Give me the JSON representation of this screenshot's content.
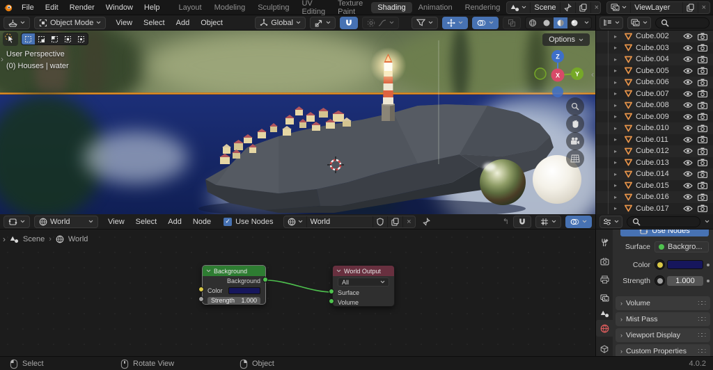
{
  "topbar": {
    "menus": [
      "File",
      "Edit",
      "Render",
      "Window",
      "Help"
    ],
    "workspaces": [
      "Layout",
      "Modeling",
      "Sculpting",
      "UV Editing",
      "Texture Paint",
      "Shading",
      "Animation",
      "Rendering"
    ],
    "active_workspace": "Shading",
    "scene": {
      "value": "Scene"
    },
    "view_layer": {
      "value": "ViewLayer"
    }
  },
  "viewport": {
    "header": {
      "mode": "Object Mode",
      "menus": [
        "View",
        "Select",
        "Add",
        "Object"
      ],
      "orientation": "Global"
    },
    "options_button": "Options",
    "overlay_line1": "User Perspective",
    "overlay_line2": "(0) Houses | water",
    "gizmo": {
      "x": "X",
      "y": "Y",
      "z": "Z"
    }
  },
  "outliner": {
    "items": [
      "Cube.002",
      "Cube.003",
      "Cube.004",
      "Cube.005",
      "Cube.006",
      "Cube.007",
      "Cube.008",
      "Cube.009",
      "Cube.010",
      "Cube.011",
      "Cube.012",
      "Cube.013",
      "Cube.014",
      "Cube.015",
      "Cube.016",
      "Cube.017"
    ]
  },
  "node_editor": {
    "header": {
      "shader_type": "World",
      "menus": [
        "View",
        "Select",
        "Add",
        "Node"
      ],
      "use_nodes": "Use Nodes",
      "id_name": "World"
    },
    "breadcrumb": {
      "scene": "Scene",
      "world": "World"
    },
    "background_node": {
      "title": "Background",
      "output_label": "Background",
      "color_label": "Color",
      "strength_label": "Strength",
      "strength_value": "1.000"
    },
    "output_node": {
      "title": "World Output",
      "target": "All",
      "surface_label": "Surface",
      "volume_label": "Volume"
    }
  },
  "properties": {
    "use_nodes_button": "Use Nodes",
    "surface": {
      "label": "Surface",
      "value": "Backgro..."
    },
    "color": {
      "label": "Color"
    },
    "strength": {
      "label": "Strength",
      "value": "1.000"
    },
    "panels": [
      "Volume",
      "Mist Pass",
      "Viewport Display",
      "Custom Properties"
    ]
  },
  "statusbar": {
    "keymap": [
      {
        "button": "left",
        "label": "Select"
      },
      {
        "button": "middle",
        "label": "Rotate View"
      },
      {
        "button": "right",
        "label": "Object"
      }
    ],
    "version": "4.0.2"
  },
  "colors": {
    "accent_blue": "#4772b3",
    "node_background_header": "#2e7d32",
    "node_output_header": "#68303f",
    "link_green": "#4ec14e",
    "world_color_swatch": "#16165c",
    "horizon_orange": "#e8941a",
    "mesh_icon_orange": "#e8944a",
    "world_tab_red": "#e05d5d"
  }
}
